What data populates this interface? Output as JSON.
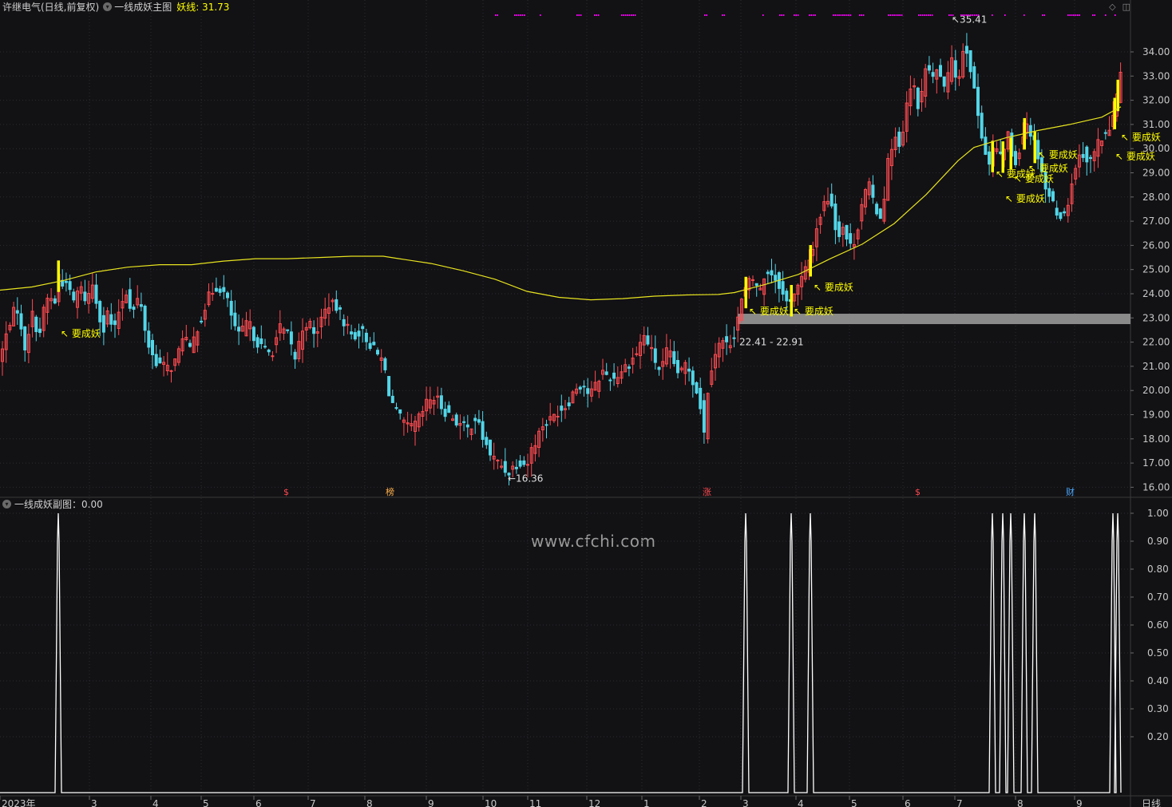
{
  "header": {
    "stock_label": "许继电气(日线,前复权)",
    "indicator_label": "一线成妖主图",
    "value_label": "妖线: 31.73"
  },
  "sub_header": {
    "label": "一线成妖副图：0.00"
  },
  "watermark": "www.cfchi.com",
  "period_label": "日线",
  "colors": {
    "up": "#ff4b50",
    "down": "#52d6e8",
    "yao_line": "#e7e41f",
    "signal": "#ffff00",
    "magenta": "#ff00ff",
    "subline": "#ffffff"
  },
  "chart_data": [
    {
      "type": "candlestick",
      "title": "一线成妖主图",
      "series_name": "妖线",
      "last_value": 31.73,
      "ylim": [
        15.8,
        35.6
      ],
      "y_ticks": [
        "34.00",
        "33.00",
        "32.00",
        "31.00",
        "30.00",
        "29.00",
        "28.00",
        "27.00",
        "26.00",
        "25.00",
        "24.00",
        "23.00",
        "22.00",
        "21.00",
        "20.00",
        "19.00",
        "18.00",
        "17.00",
        "16.00"
      ],
      "x_ticks": [
        "2023年",
        "3",
        "4",
        "5",
        "6",
        "7",
        "8",
        "9",
        "10",
        "11",
        "12",
        "1",
        "2",
        "3",
        "4",
        "5",
        "6",
        "7",
        "8",
        "9"
      ],
      "price_path": [
        [
          0,
          21.3
        ],
        [
          8,
          22.3
        ],
        [
          14,
          23.1
        ],
        [
          22,
          23.4
        ],
        [
          26,
          22.5
        ],
        [
          32,
          21.7
        ],
        [
          36,
          22.5
        ],
        [
          42,
          23.3
        ],
        [
          48,
          22.1
        ],
        [
          56,
          23.5
        ],
        [
          62,
          24.0
        ],
        [
          68,
          23.3
        ],
        [
          72,
          25.1
        ],
        [
          76,
          24.2
        ],
        [
          84,
          24.7
        ],
        [
          90,
          23.5
        ],
        [
          100,
          24.3
        ],
        [
          108,
          23.7
        ],
        [
          116,
          24.4
        ],
        [
          124,
          23.2
        ],
        [
          130,
          22.5
        ],
        [
          136,
          23.4
        ],
        [
          142,
          22.2
        ],
        [
          150,
          23.5
        ],
        [
          158,
          24.1
        ],
        [
          166,
          23.2
        ],
        [
          174,
          23.9
        ],
        [
          182,
          22.5
        ],
        [
          188,
          21.6
        ],
        [
          196,
          21.2
        ],
        [
          204,
          21.0
        ],
        [
          212,
          20.9
        ],
        [
          222,
          21.3
        ],
        [
          230,
          22.5
        ],
        [
          238,
          21.6
        ],
        [
          246,
          22.5
        ],
        [
          254,
          23.2
        ],
        [
          262,
          23.9
        ],
        [
          270,
          24.3
        ],
        [
          278,
          24.2
        ],
        [
          286,
          23.6
        ],
        [
          292,
          22.8
        ],
        [
          300,
          22.2
        ],
        [
          310,
          22.9
        ],
        [
          320,
          22.1
        ],
        [
          330,
          21.7
        ],
        [
          340,
          21.5
        ],
        [
          350,
          22.6
        ],
        [
          360,
          22.3
        ],
        [
          370,
          21.3
        ],
        [
          378,
          22.5
        ],
        [
          386,
          22.9
        ],
        [
          394,
          22.2
        ],
        [
          404,
          23.1
        ],
        [
          412,
          23.6
        ],
        [
          422,
          23.4
        ],
        [
          432,
          22.8
        ],
        [
          442,
          22.2
        ],
        [
          452,
          22.5
        ],
        [
          462,
          22.0
        ],
        [
          472,
          21.5
        ],
        [
          480,
          21.2
        ],
        [
          488,
          19.8
        ],
        [
          496,
          19.1
        ],
        [
          504,
          18.7
        ],
        [
          512,
          18.4
        ],
        [
          520,
          18.6
        ],
        [
          528,
          19.0
        ],
        [
          536,
          19.6
        ],
        [
          546,
          19.7
        ],
        [
          556,
          19.2
        ],
        [
          566,
          18.9
        ],
        [
          576,
          18.6
        ],
        [
          586,
          18.4
        ],
        [
          596,
          18.9
        ],
        [
          604,
          18.1
        ],
        [
          612,
          17.5
        ],
        [
          620,
          17.1
        ],
        [
          628,
          16.9
        ],
        [
          636,
          16.6
        ],
        [
          644,
          16.9
        ],
        [
          652,
          17.1
        ],
        [
          660,
          16.9
        ],
        [
          666,
          17.6
        ],
        [
          672,
          18.0
        ],
        [
          680,
          18.6
        ],
        [
          690,
          18.8
        ],
        [
          700,
          19.2
        ],
        [
          710,
          19.4
        ],
        [
          720,
          20.1
        ],
        [
          730,
          20.3
        ],
        [
          738,
          19.8
        ],
        [
          746,
          20.2
        ],
        [
          754,
          20.8
        ],
        [
          762,
          20.6
        ],
        [
          770,
          20.5
        ],
        [
          780,
          20.9
        ],
        [
          790,
          21.2
        ],
        [
          798,
          21.6
        ],
        [
          806,
          22.3
        ],
        [
          814,
          21.8
        ],
        [
          822,
          21.1
        ],
        [
          828,
          20.8
        ],
        [
          836,
          21.7
        ],
        [
          844,
          21.1
        ],
        [
          852,
          20.6
        ],
        [
          860,
          21.2
        ],
        [
          868,
          20.4
        ],
        [
          876,
          19.7
        ],
        [
          882,
          18.2
        ],
        [
          888,
          20.6
        ],
        [
          896,
          21.6
        ],
        [
          904,
          22.1
        ],
        [
          912,
          21.8
        ],
        [
          920,
          22.4
        ],
        [
          928,
          23.6
        ],
        [
          936,
          24.4
        ],
        [
          944,
          24.6
        ],
        [
          952,
          24.1
        ],
        [
          960,
          25.0
        ],
        [
          968,
          24.8
        ],
        [
          976,
          24.4
        ],
        [
          984,
          23.6
        ],
        [
          992,
          23.9
        ],
        [
          1000,
          24.3
        ],
        [
          1008,
          24.9
        ],
        [
          1016,
          25.6
        ],
        [
          1024,
          26.9
        ],
        [
          1032,
          27.7
        ],
        [
          1040,
          28.1
        ],
        [
          1048,
          26.4
        ],
        [
          1056,
          26.8
        ],
        [
          1064,
          25.9
        ],
        [
          1072,
          26.3
        ],
        [
          1080,
          27.9
        ],
        [
          1088,
          28.5
        ],
        [
          1096,
          27.6
        ],
        [
          1104,
          27.1
        ],
        [
          1112,
          29.4
        ],
        [
          1120,
          30.6
        ],
        [
          1128,
          29.8
        ],
        [
          1136,
          31.9
        ],
        [
          1144,
          32.7
        ],
        [
          1152,
          31.5
        ],
        [
          1160,
          33.6
        ],
        [
          1168,
          32.8
        ],
        [
          1176,
          33.4
        ],
        [
          1184,
          32.2
        ],
        [
          1192,
          33.9
        ],
        [
          1200,
          32.6
        ],
        [
          1208,
          34.6
        ],
        [
          1216,
          33.3
        ],
        [
          1222,
          31.9
        ],
        [
          1230,
          30.6
        ],
        [
          1238,
          29.2
        ],
        [
          1246,
          30.2
        ],
        [
          1254,
          29.5
        ],
        [
          1262,
          30.7
        ],
        [
          1270,
          29.2
        ],
        [
          1278,
          30.2
        ],
        [
          1286,
          31.1
        ],
        [
          1294,
          30.4
        ],
        [
          1302,
          29.6
        ],
        [
          1310,
          28.3
        ],
        [
          1318,
          27.8
        ],
        [
          1326,
          27.3
        ],
        [
          1334,
          27.2
        ],
        [
          1340,
          28.2
        ],
        [
          1348,
          29.4
        ],
        [
          1356,
          29.9
        ],
        [
          1364,
          29.3
        ],
        [
          1372,
          30.0
        ],
        [
          1380,
          30.5
        ],
        [
          1388,
          30.6
        ],
        [
          1396,
          31.6
        ],
        [
          1404,
          33.1
        ],
        [
          1410,
          33.9
        ]
      ],
      "yao_line_path": [
        [
          0,
          24.15
        ],
        [
          40,
          24.28
        ],
        [
          80,
          24.55
        ],
        [
          120,
          24.9
        ],
        [
          160,
          25.1
        ],
        [
          200,
          25.2
        ],
        [
          240,
          25.2
        ],
        [
          280,
          25.35
        ],
        [
          320,
          25.45
        ],
        [
          360,
          25.45
        ],
        [
          400,
          25.5
        ],
        [
          440,
          25.55
        ],
        [
          480,
          25.55
        ],
        [
          500,
          25.45
        ],
        [
          540,
          25.25
        ],
        [
          580,
          24.95
        ],
        [
          620,
          24.6
        ],
        [
          660,
          24.1
        ],
        [
          700,
          23.85
        ],
        [
          740,
          23.75
        ],
        [
          780,
          23.8
        ],
        [
          820,
          23.9
        ],
        [
          860,
          23.95
        ],
        [
          900,
          23.97
        ],
        [
          920,
          24.05
        ],
        [
          960,
          24.4
        ],
        [
          1000,
          24.8
        ],
        [
          1040,
          25.45
        ],
        [
          1080,
          26.05
        ],
        [
          1120,
          26.9
        ],
        [
          1160,
          28.1
        ],
        [
          1200,
          29.5
        ],
        [
          1220,
          30.05
        ],
        [
          1260,
          30.45
        ],
        [
          1300,
          30.75
        ],
        [
          1340,
          31.0
        ],
        [
          1380,
          31.3
        ],
        [
          1404,
          31.73
        ]
      ],
      "annotations": [
        {
          "text": "35.41",
          "price": 35.41
        },
        {
          "text": "16.36",
          "price": 16.36
        },
        {
          "text": "22.41 - 22.91",
          "price": 22.91
        }
      ],
      "signal_label": "要成妖",
      "bottom_markers": [
        "$",
        "榜",
        "涨",
        "$",
        "财"
      ]
    },
    {
      "type": "line",
      "title": "一线成妖副图",
      "ylim": [
        0,
        1.0
      ],
      "y_ticks": [
        "1.00",
        "0.90",
        "0.80",
        "0.70",
        "0.60",
        "0.50",
        "0.40",
        "0.30",
        "0.20"
      ],
      "current_value": 0.0,
      "signal_dates": [
        "2023-02-23",
        "2024-03-04",
        "2024-03-28",
        "2024-04-05",
        "2024-07-22",
        "2024-07-29",
        "2024-08-02",
        "2024-08-07",
        "2024-08-13",
        "2024-08-19",
        "2024-09-27",
        "2024-09-30"
      ]
    }
  ]
}
